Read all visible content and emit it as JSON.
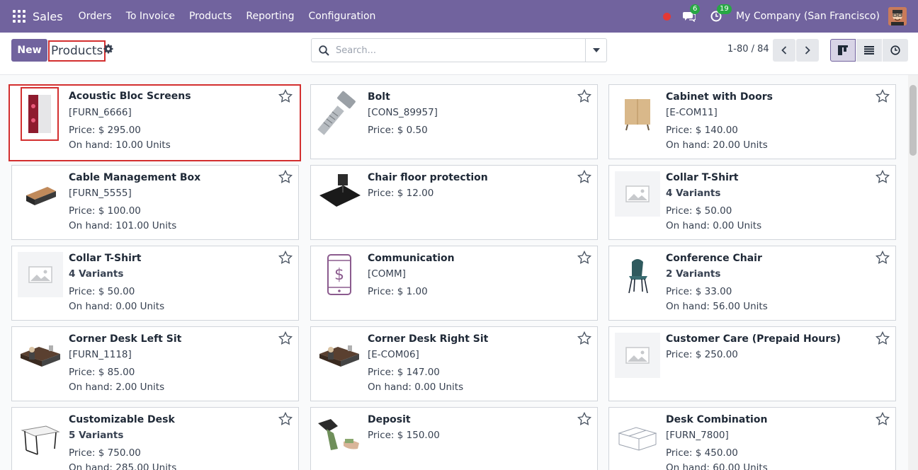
{
  "navbar": {
    "app_name": "Sales",
    "menu": [
      "Orders",
      "To Invoice",
      "Products",
      "Reporting",
      "Configuration"
    ],
    "messages_count": "6",
    "activities_count": "19",
    "company": "My Company (San Francisco)"
  },
  "control": {
    "new_label": "New",
    "breadcrumb": "Products",
    "search_placeholder": "Search...",
    "pager": "1-80 / 84"
  },
  "products": [
    {
      "name": "Acoustic Bloc Screens",
      "line1": "[FURN_6666]",
      "line1_bold": false,
      "price": "Price: $ 295.00",
      "onhand": "On hand: 10.00 Units",
      "image": "pc-case"
    },
    {
      "name": "Bolt",
      "line1": "[CONS_89957]",
      "line1_bold": false,
      "price": "Price: $ 0.50",
      "onhand": "",
      "image": "bolt"
    },
    {
      "name": "Cabinet with Doors",
      "line1": "[E-COM11]",
      "line1_bold": false,
      "price": "Price: $ 140.00",
      "onhand": "On hand: 20.00 Units",
      "image": "cabinet"
    },
    {
      "name": "Cable Management Box",
      "line1": "[FURN_5555]",
      "line1_bold": false,
      "price": "Price: $ 100.00",
      "onhand": "On hand: 101.00 Units",
      "image": "cable-box"
    },
    {
      "name": "Chair floor protection",
      "line1": "",
      "line1_bold": false,
      "price": "Price: $ 12.00",
      "onhand": "",
      "image": "floor-mat"
    },
    {
      "name": "Collar T-Shirt",
      "line1": "4 Variants",
      "line1_bold": true,
      "price": "Price: $ 50.00",
      "onhand": "On hand: 0.00 Units",
      "image": "placeholder"
    },
    {
      "name": "Collar T-Shirt",
      "line1": "4 Variants",
      "line1_bold": true,
      "price": "Price: $ 50.00",
      "onhand": "On hand: 0.00 Units",
      "image": "placeholder"
    },
    {
      "name": "Communication",
      "line1": "[COMM]",
      "line1_bold": false,
      "price": "Price: $ 1.00",
      "onhand": "",
      "image": "phone-dollar"
    },
    {
      "name": "Conference Chair",
      "line1": "2 Variants",
      "line1_bold": true,
      "price": "Price: $ 33.00",
      "onhand": "On hand: 56.00 Units",
      "image": "chair"
    },
    {
      "name": "Corner Desk Left Sit",
      "line1": "[FURN_1118]",
      "line1_bold": false,
      "price": "Price: $ 85.00",
      "onhand": "On hand: 2.00 Units",
      "image": "desk"
    },
    {
      "name": "Corner Desk Right Sit",
      "line1": "[E-COM06]",
      "line1_bold": false,
      "price": "Price: $ 147.00",
      "onhand": "On hand: 0.00 Units",
      "image": "desk"
    },
    {
      "name": "Customer Care (Prepaid Hours)",
      "line1": "",
      "line1_bold": false,
      "price": "Price: $ 250.00",
      "onhand": "",
      "image": "placeholder"
    },
    {
      "name": "Customizable Desk",
      "line1": "5 Variants",
      "line1_bold": true,
      "price": "Price: $ 750.00",
      "onhand": "On hand: 285.00 Units",
      "image": "table"
    },
    {
      "name": "Deposit",
      "line1": "",
      "line1_bold": false,
      "price": "Price: $ 150.00",
      "onhand": "",
      "image": "money"
    },
    {
      "name": "Desk Combination",
      "line1": "[FURN_7800]",
      "line1_bold": false,
      "price": "Price: $ 450.00",
      "onhand": "On hand: 60.00 Units",
      "image": "desk-combo"
    }
  ]
}
